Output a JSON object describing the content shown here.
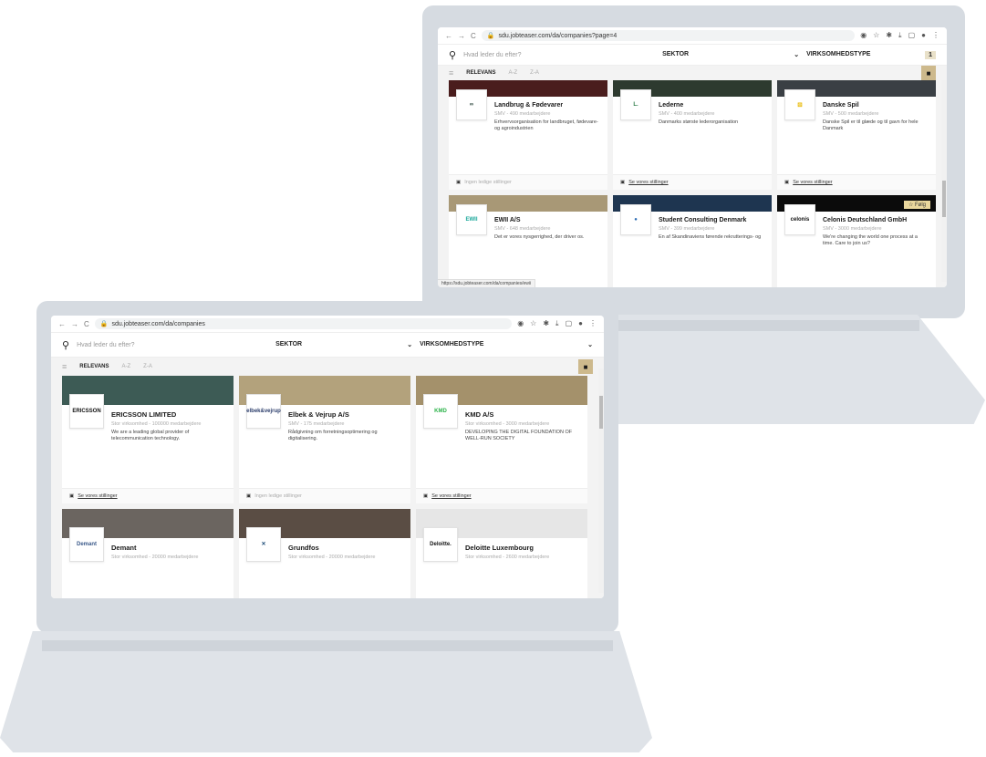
{
  "back_browser": {
    "url": "sdu.jobteaser.com/da/companies?page=4",
    "search_placeholder": "Hvad leder du efter?",
    "filter_sector": "SEKTOR",
    "filter_type": "VIRKSOMHEDSTYPE",
    "filter_count": "1",
    "sort": {
      "relevance": "RELEVANS",
      "az": "A-Z",
      "za": "Z-A"
    },
    "status_url": "https://sdu.jobteaser.com/da/companies/ewii",
    "cards": [
      {
        "name": "Landbrug & Fødevarer",
        "size": "SMV - 490 medarbejdere",
        "desc": "Erhvervsorganisation for landbruget, fødevare- og agroindustrien",
        "footer": "Ingen ledige stillinger",
        "logo": "∞",
        "logo_color": "#1f3a30",
        "banner": "#4a1d1d"
      },
      {
        "name": "Lederne",
        "size": "SMV - 400 medarbejdere",
        "desc": "Danmarks største lederorganisation",
        "footer": "Se vores stillinger",
        "logo": "L.",
        "logo_color": "#2a7a46",
        "banner": "#2d3a2f"
      },
      {
        "name": "Danske Spil",
        "size": "SMV - 500 medarbejdere",
        "desc": "Danske Spil er til glæde og til gavn for hele Danmark",
        "footer": "Se vores stillinger",
        "logo": "⚄",
        "logo_color": "#e8b800",
        "banner": "#3a3f44"
      },
      {
        "name": "EWII A/S",
        "size": "SMV - 648 medarbejdere",
        "desc": "Det er vores nysgerrighed, der driver os.",
        "footer": "",
        "logo": "EWII",
        "logo_color": "#19a79a",
        "banner": "#a89876"
      },
      {
        "name": "Student Consulting Denmark",
        "size": "SMV - 399 medarbejdere",
        "desc": "En af Skandinaviens førende rekrutterings- og",
        "footer": "",
        "logo": "●",
        "logo_color": "#2a6bb3",
        "banner": "#1e3550"
      },
      {
        "name": "Celonis Deutschland GmbH",
        "size": "SMV - 3000 medarbejdere",
        "desc": "We're changing the world one process at a time. Care to join us?",
        "footer": "",
        "logo": "celonis",
        "logo_color": "#111111",
        "banner": "#0b0b0b",
        "follow": "☆ Følg"
      }
    ]
  },
  "front_browser": {
    "url": "sdu.jobteaser.com/da/companies",
    "search_placeholder": "Hvad leder du efter?",
    "filter_sector": "SEKTOR",
    "filter_type": "VIRKSOMHEDSTYPE",
    "sort": {
      "relevance": "RELEVANS",
      "az": "A-Z",
      "za": "Z-A"
    },
    "cards": [
      {
        "name": "ERICSSON LIMITED",
        "size": "Stor virksomhed - 100000 medarbejdere",
        "desc": "We are a leading global provider of telecommunication technology.",
        "footer": "Se vores stillinger",
        "logo": "ERICSSON",
        "logo_color": "#111111",
        "banner": "#3d5b55"
      },
      {
        "name": "Elbek & Vejrup A/S",
        "size": "SMV - 175 medarbejdere",
        "desc": "Rådgivning om forretningsoptimering og digitalisering.",
        "footer": "Ingen ledige stillinger",
        "logo": "elbek&vejrup",
        "logo_color": "#2b3d6b",
        "banner": "#b3a27c"
      },
      {
        "name": "KMD A/S",
        "size": "Stor virksomhed - 3000 medarbejdere",
        "desc": "DEVELOPING THE DIGITAL FOUNDATION OF WELL-RUN SOCIETY",
        "footer": "Se vores stillinger",
        "logo": "KMD",
        "logo_color": "#2cb34a",
        "banner": "#a4916b"
      },
      {
        "name": "Demant",
        "size": "Stor virksomhed - 20000 medarbejdere",
        "desc": "",
        "footer": "",
        "logo": "Demant",
        "logo_color": "#3b5a8a",
        "banner": "#6b6560"
      },
      {
        "name": "Grundfos",
        "size": "Stor virksomhed - 20000 medarbejdere",
        "desc": "",
        "footer": "",
        "logo": "✕",
        "logo_color": "#1f4e79",
        "banner": "#5a4d44"
      },
      {
        "name": "Deloitte Luxembourg",
        "size": "Stor virksomhed - 2600 medarbejdere",
        "desc": "",
        "footer": "",
        "logo": "Deloitte.",
        "logo_color": "#111111",
        "banner": "#e6e6e6"
      }
    ]
  },
  "icons": {
    "back": "←",
    "forward": "→",
    "reload": "C",
    "lock": "🔒",
    "search": "🔍",
    "briefcase": "▣",
    "trash": "🗑"
  }
}
